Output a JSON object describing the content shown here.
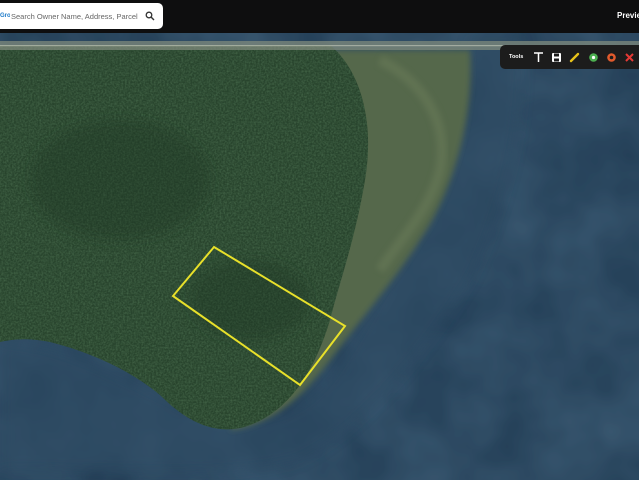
{
  "search": {
    "brand_label": "Grow",
    "placeholder": "Search Owner Name, Address, Parcel Id",
    "icon": "search-icon"
  },
  "header": {
    "preview_label": "Preview"
  },
  "toolbar": {
    "label": "Tools",
    "tools": [
      {
        "icon": "text-tool-icon",
        "color": "#ffffff"
      },
      {
        "icon": "save-tool-icon",
        "color": "#ffffff"
      },
      {
        "icon": "draw-tool-icon",
        "color": "#e8c21a"
      },
      {
        "icon": "locate-tool-icon",
        "color": "#4caf50"
      },
      {
        "icon": "erase-tool-icon",
        "color": "#e25a2c"
      },
      {
        "icon": "clear-tool-icon",
        "color": "#e53935"
      }
    ]
  },
  "map": {
    "view": "satellite",
    "parcel_outline_color": "#e8e02a",
    "forest_color": "#2b4630",
    "water_color": "#1f3a52",
    "marsh_color": "#59704f"
  }
}
